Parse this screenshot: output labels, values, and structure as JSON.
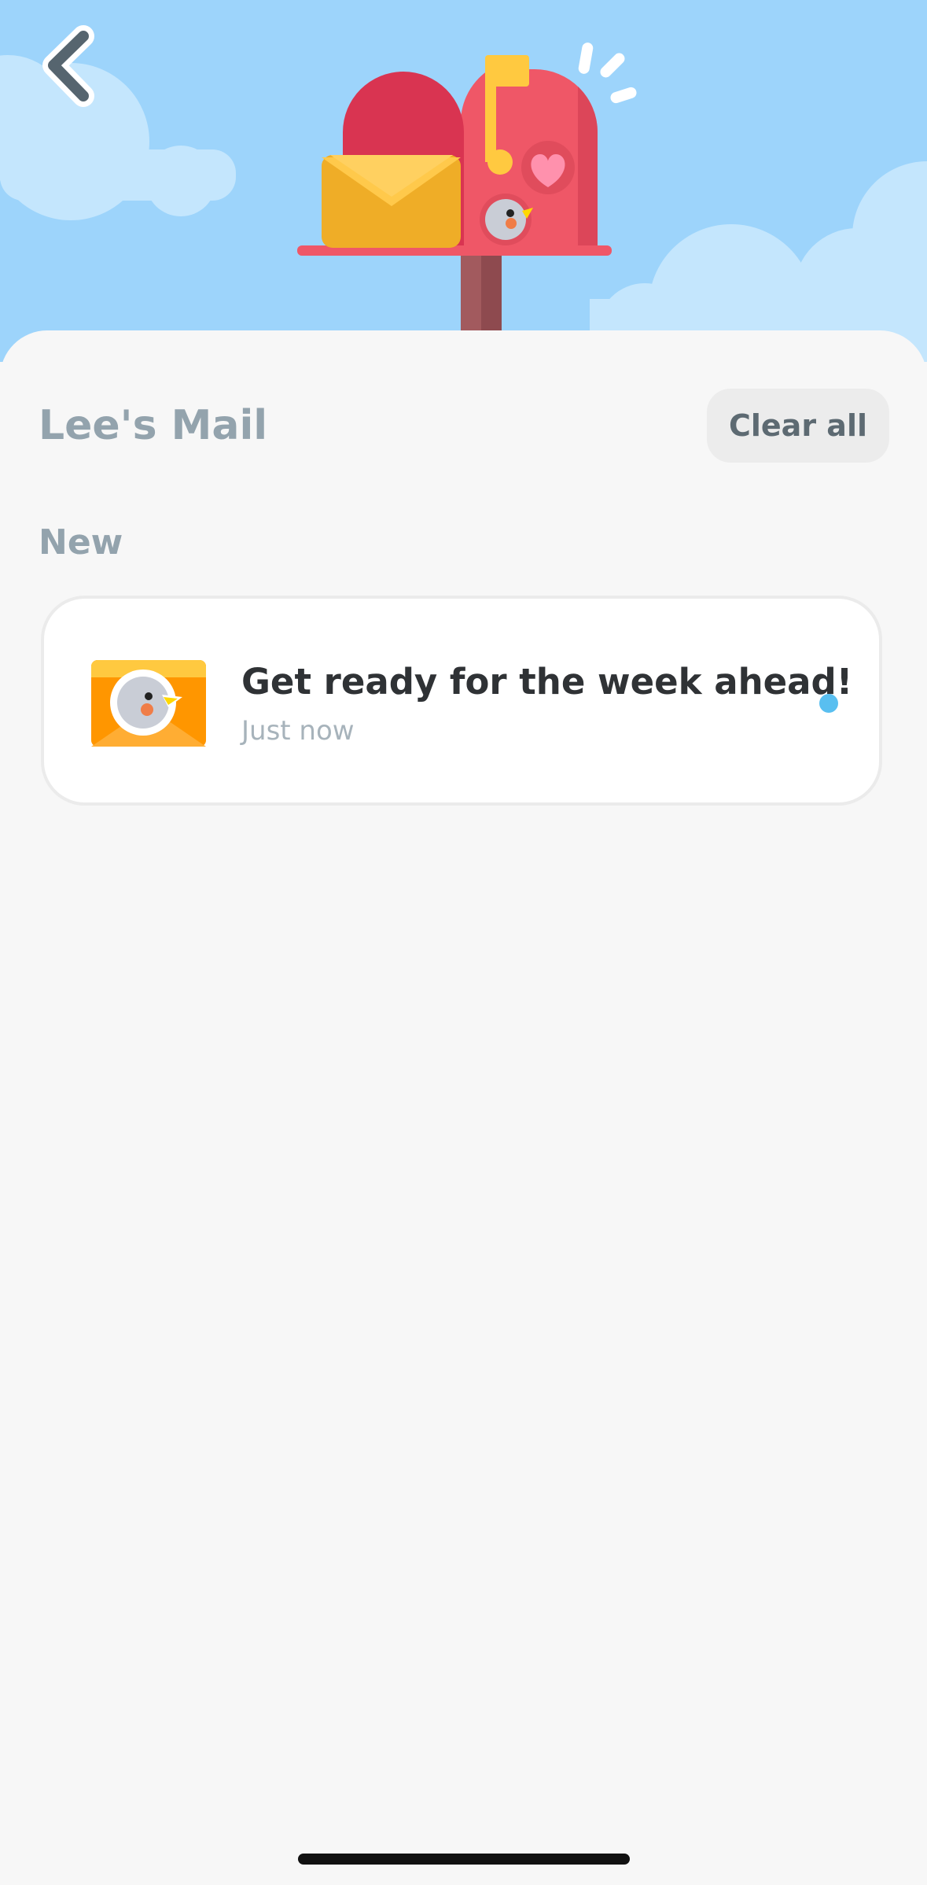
{
  "header": {
    "back_icon": "chevron-left-icon",
    "illustration": "mailbox-illustration"
  },
  "mailbox": {
    "title": "Lee's Mail",
    "clear_all_label": "Clear all"
  },
  "sections": [
    {
      "label": "New",
      "items": [
        {
          "icon": "envelope-owl-icon",
          "title": "Get ready for the week ahead!",
          "time": "Just now",
          "unread": true
        }
      ]
    }
  ],
  "colors": {
    "sky": "#9dd4fb",
    "unread_dot": "#59bff0",
    "mailbox_red": "#ef5767",
    "envelope_orange": "#ff9600"
  }
}
